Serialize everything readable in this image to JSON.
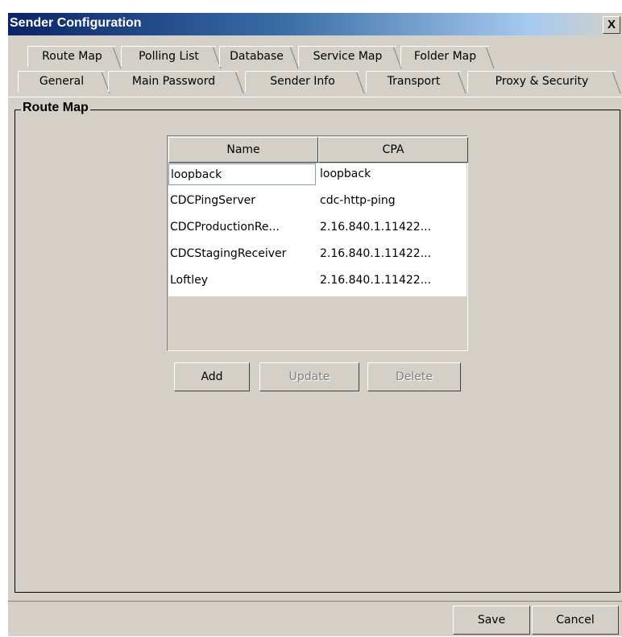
{
  "window": {
    "title": "Sender Configuration",
    "close_label": "X"
  },
  "tabs_top": [
    "Route Map",
    "Polling List",
    "Database",
    "Service Map",
    "Folder Map"
  ],
  "tabs_bottom": [
    "General",
    "Main Password",
    "Sender Info",
    "Transport",
    "Proxy & Security"
  ],
  "active_tab": "Route Map",
  "group_title": "Route Map",
  "table": {
    "headers": [
      "Name",
      "CPA"
    ],
    "rows": [
      [
        "loopback",
        "loopback"
      ],
      [
        "CDCPingServer",
        "cdc-http-ping"
      ],
      [
        "CDCProductionRe...",
        "2.16.840.1.11422..."
      ],
      [
        "CDCStagingReceiver",
        "2.16.840.1.11422..."
      ],
      [
        "Loftley",
        "2.16.840.1.11422..."
      ]
    ],
    "selected_row": 0
  },
  "table_buttons": {
    "add": "Add",
    "update": "Update",
    "delete": "Delete"
  },
  "footer": {
    "save": "Save",
    "cancel": "Cancel"
  }
}
